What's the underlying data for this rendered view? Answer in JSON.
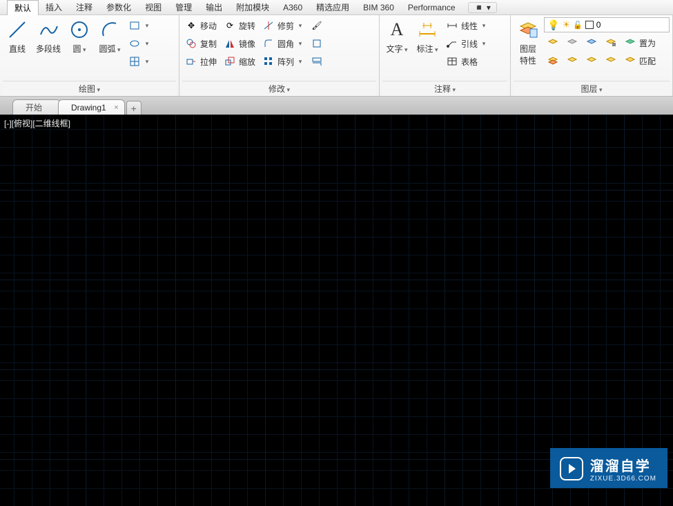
{
  "menu": {
    "items": [
      "默认",
      "插入",
      "注释",
      "参数化",
      "视图",
      "管理",
      "输出",
      "附加模块",
      "A360",
      "精选应用",
      "BIM 360",
      "Performance"
    ],
    "overflow": "▸"
  },
  "ribbon": {
    "draw": {
      "title": "绘图",
      "line": "直线",
      "polyline": "多段线",
      "circle": "圆",
      "arc": "圆弧"
    },
    "modify": {
      "title": "修改",
      "move": "移动",
      "copy": "复制",
      "stretch": "拉伸",
      "rotate": "旋转",
      "mirror": "镜像",
      "scale": "缩放",
      "trim": "修剪",
      "fillet": "圆角",
      "array": "阵列"
    },
    "annotation": {
      "title": "注释",
      "text": "文字",
      "dim": "标注",
      "linear": "线性",
      "leader": "引线",
      "table": "表格"
    },
    "layers": {
      "title": "图层",
      "props": "图层\n特性",
      "status_value": "0",
      "setcurrent": "置为"
    }
  },
  "tabs": {
    "start": "开始",
    "drawing": "Drawing1",
    "add": "+"
  },
  "canvas": {
    "viewlabel": "[-][俯视][二维线框]"
  },
  "watermark": {
    "title": "溜溜自学",
    "sub": "ZIXUE.3D66.COM"
  }
}
